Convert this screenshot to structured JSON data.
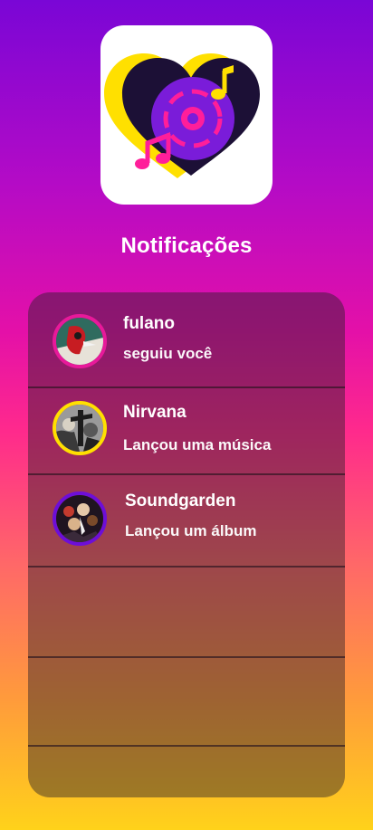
{
  "page": {
    "title": "Notificações"
  },
  "notifications": [
    {
      "name": "fulano",
      "message": "seguiu você",
      "ring_color": "#e8199a"
    },
    {
      "name": "Nirvana",
      "message": "Lançou uma música",
      "ring_color": "#ffe000"
    },
    {
      "name": "Soundgarden",
      "message": "Lançou um álbum",
      "ring_color": "#6d0ed8"
    }
  ],
  "empty_rows": 3,
  "colors": {
    "background_top": "#7a06d6",
    "background_middle": "#ff2a8c",
    "background_bottom": "#ffd21a",
    "heart": "#1c1036",
    "heart_shadow": "#ffe000",
    "vinyl": "#7a1cd9",
    "notes": "#ff1e9a"
  },
  "icons": [
    "app-logo-heart-vinyl-icon",
    "music-note-icon"
  ]
}
